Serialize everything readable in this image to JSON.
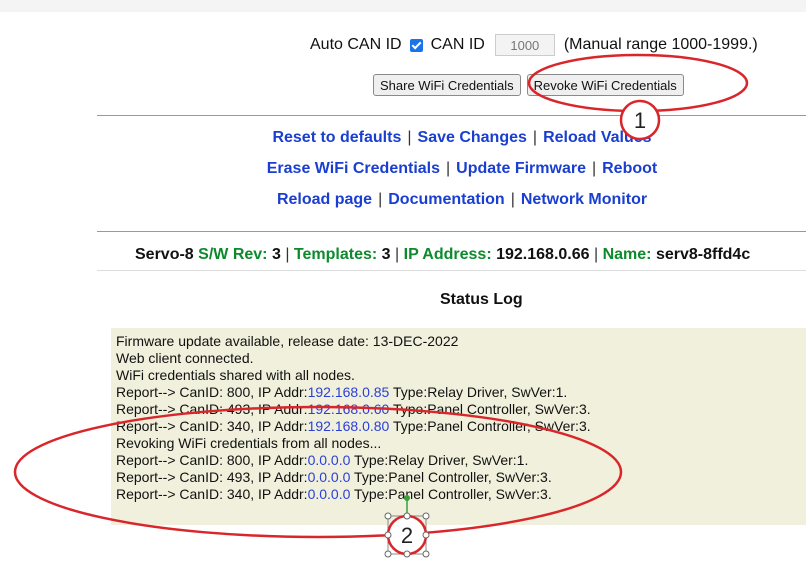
{
  "canid": {
    "auto_label": "Auto CAN ID",
    "auto_checked": true,
    "canid_label": "CAN ID",
    "canid_value": "1000",
    "range_note": "(Manual range 1000-1999.)"
  },
  "buttons": {
    "share": "Share WiFi Credentials",
    "revoke": "Revoke WiFi Credentials"
  },
  "links": {
    "reset": "Reset to defaults",
    "save": "Save Changes",
    "reload_values": "Reload Values",
    "erase": "Erase WiFi Credentials",
    "update": "Update Firmware",
    "reboot": "Reboot",
    "reload_page": "Reload page",
    "docs": "Documentation",
    "network": "Network Monitor",
    "separator": "|"
  },
  "status": {
    "device": "Servo-8",
    "sw_label": "S/W Rev:",
    "sw_value": "3",
    "templates_label": "Templates:",
    "templates_value": "3",
    "ip_label": "IP Address:",
    "ip_value": "192.168.0.66",
    "name_label": "Name:",
    "name_value": "serv8-8ffd4c"
  },
  "log": {
    "title": "Status Log",
    "lines": [
      {
        "pre": "Firmware update available, release date: 13-DEC-2022",
        "ip": "",
        "post": ""
      },
      {
        "pre": "Web client connected.",
        "ip": "",
        "post": ""
      },
      {
        "pre": "WiFi credentials shared with all nodes.",
        "ip": "",
        "post": ""
      },
      {
        "pre": "Report--> CanID: 800, IP Addr:",
        "ip": "192.168.0.85",
        "post": " Type:Relay Driver, SwVer:1."
      },
      {
        "pre": "Report--> CanID: 493, IP Addr:",
        "ip": "192.168.0.60",
        "post": " Type:Panel Controller, SwVer:3."
      },
      {
        "pre": "Report--> CanID: 340, IP Addr:",
        "ip": "192.168.0.80",
        "post": " Type:Panel Controller, SwVer:3."
      },
      {
        "pre": "Revoking WiFi credentials from all nodes...",
        "ip": "",
        "post": ""
      },
      {
        "pre": "Report--> CanID: 800, IP Addr:",
        "ip": "0.0.0.0",
        "post": " Type:Relay Driver, SwVer:1."
      },
      {
        "pre": "Report--> CanID: 493, IP Addr:",
        "ip": "0.0.0.0",
        "post": " Type:Panel Controller, SwVer:3."
      },
      {
        "pre": "Report--> CanID: 340, IP Addr:",
        "ip": "0.0.0.0",
        "post": " Type:Panel Controller, SwVer:3."
      }
    ]
  },
  "annotations": {
    "marker1": "1",
    "marker2": "2",
    "color": "#d9262b"
  }
}
